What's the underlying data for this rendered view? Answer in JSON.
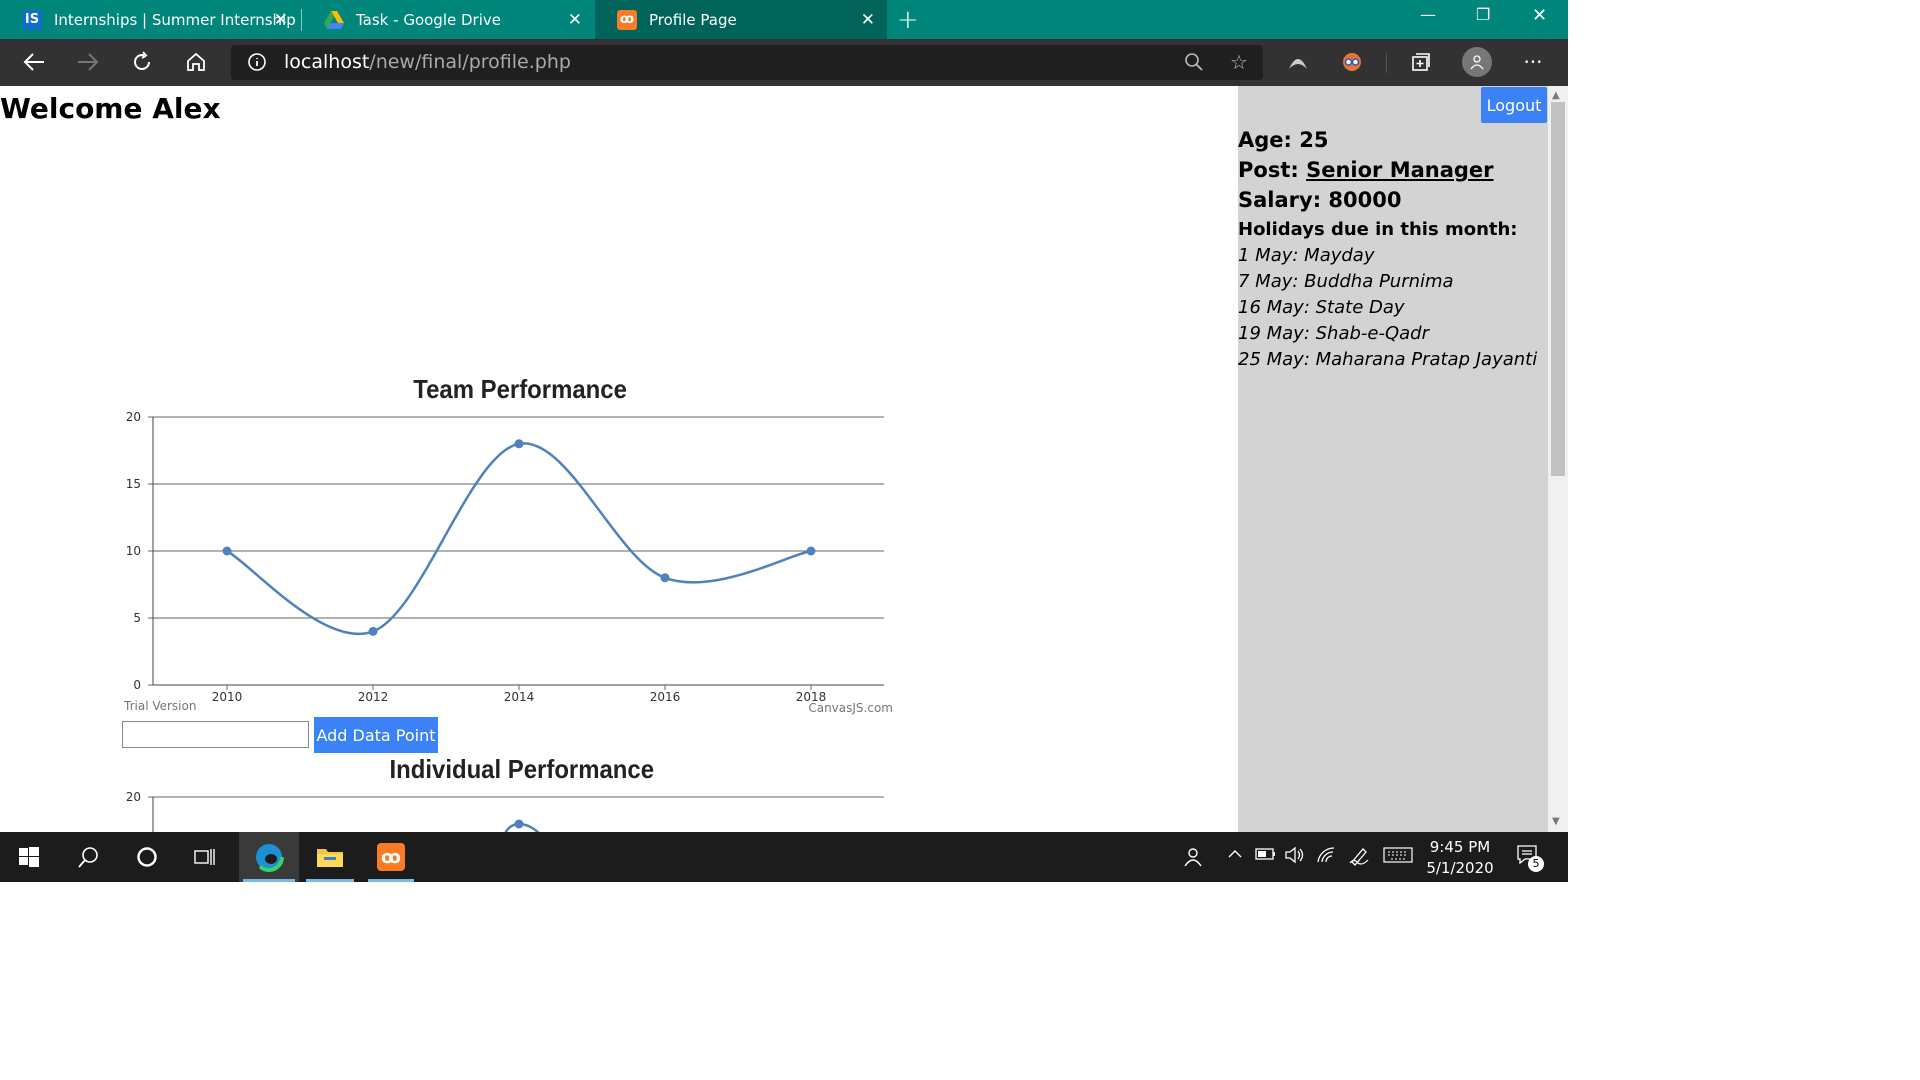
{
  "browser": {
    "tabs": [
      {
        "title": "Internships | Summer Internship",
        "favicon": "IS"
      },
      {
        "title": "Task - Google Drive",
        "favicon": "drive-icon"
      },
      {
        "title": "Profile Page",
        "favicon": "xampp-icon"
      }
    ],
    "url_host": "localhost",
    "url_path": "/new/final/profile.php"
  },
  "page": {
    "welcome": "Welcome Alex",
    "logout_label": "Logout",
    "profile": {
      "age_label": "Age:",
      "age": "25",
      "post_label": "Post:",
      "post": "Senior Manager",
      "salary_label": "Salary:",
      "salary": "80000",
      "holidays_label": "Holidays due in this month:",
      "holidays": [
        "1 May: Mayday",
        "7 May: Buddha Purnima",
        "16 May: State Day",
        "19 May: Shab-e-Qadr",
        "25 May: Maharana Pratap Jayanti"
      ]
    },
    "add_data_point_label": "Add Data Point",
    "input_value": ""
  },
  "chart_data": [
    {
      "type": "line",
      "title": "Team Performance",
      "x": [
        2010,
        2012,
        2014,
        2016,
        2018
      ],
      "y": [
        10,
        4,
        18,
        8,
        10
      ],
      "xlabel": "",
      "ylabel": "",
      "ylim": [
        0,
        20
      ],
      "y_ticks": [
        0,
        5,
        10,
        15,
        20
      ],
      "x_ticks": [
        2010,
        2012,
        2014,
        2016,
        2018
      ],
      "grid": true,
      "color": "#4f81bc",
      "watermark_left": "Trial Version",
      "watermark_right": "CanvasJS.com"
    },
    {
      "type": "line",
      "title": "Individual Performance",
      "ylim": [
        0,
        20
      ],
      "y_ticks": [
        20
      ],
      "grid": true,
      "color": "#4f81bc"
    }
  ],
  "taskbar": {
    "time": "9:45 PM",
    "date": "5/1/2020",
    "notification_count": "5"
  }
}
